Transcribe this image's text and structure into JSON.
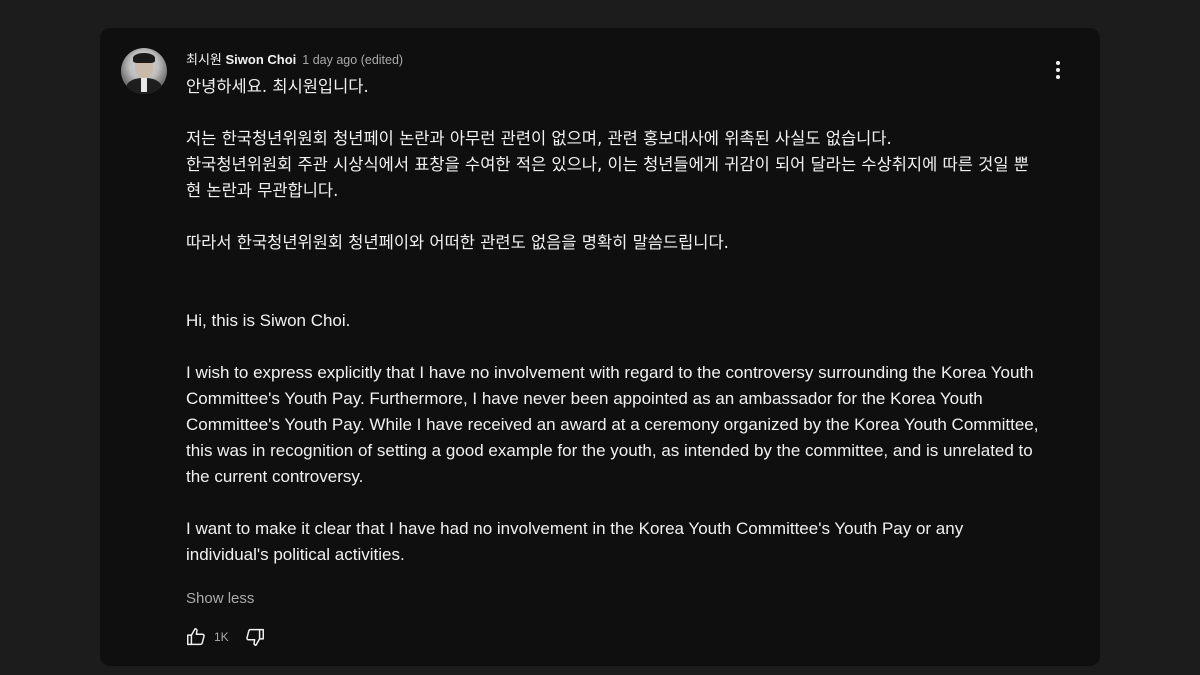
{
  "comment": {
    "author_korean": "최시원",
    "author_english": "Siwon Choi",
    "timestamp": "1 day ago",
    "edited": "(edited)",
    "paragraphs_korean": [
      "안녕하세요. 최시원입니다.",
      "저는 한국청년위원회 청년페이 논란과 아무런 관련이 없으며, 관련 홍보대사에 위촉된 사실도 없습니다.",
      "한국청년위원회 주관 시상식에서 표창을 수여한 적은 있으나, 이는 청년들에게 귀감이 되어 달라는 수상취지에 따른 것일 뿐 현 논란과 무관합니다.",
      "따라서 한국청년위원회 청년페이와 어떠한 관련도 없음을 명확히 말씀드립니다."
    ],
    "paragraphs_english": [
      "Hi, this is Siwon Choi.",
      "I wish to express explicitly that I have no involvement with regard to the controversy surrounding the Korea Youth Committee's Youth Pay. Furthermore, I have never been appointed as an ambassador for the Korea Youth Committee's Youth Pay. While I have received an award at a ceremony organized by the Korea Youth Committee, this was in recognition of setting a good example for the youth, as intended by the committee, and is unrelated to the current controversy.",
      "I want to make it clear that I have had no involvement in the Korea Youth Committee's Youth Pay or any individual's political activities."
    ],
    "show_less_label": "Show less",
    "like_count": "1K"
  },
  "icons": {
    "menu": "more-vert-icon",
    "like": "thumbs-up-icon",
    "dislike": "thumbs-down-icon"
  },
  "colors": {
    "page_background": "#1c1c1c",
    "card_background": "#0f0f0f",
    "primary_text": "#f1f1f1",
    "secondary_text": "#aaaaaa"
  }
}
